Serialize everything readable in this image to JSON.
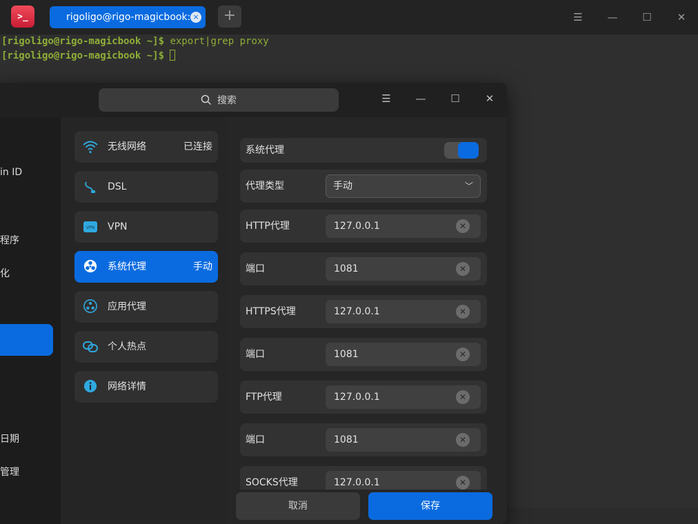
{
  "terminal": {
    "tab_title": "rigoligo@rigo-magicbook:~",
    "tab_close": "×",
    "new_tab": "+",
    "app_icon_glyph": ">_",
    "lines": [
      {
        "user": "[rigoligo@rigo-magicbook ~]$",
        "cmd": " export|grep proxy"
      },
      {
        "user": "[rigoligo@rigo-magicbook ~]$",
        "cmd": " "
      }
    ]
  },
  "window_controls": {
    "menu": "☰",
    "minimize": "—",
    "maximize": "☐",
    "close": "✕"
  },
  "settings": {
    "search_placeholder": "搜索",
    "left_items": [
      {
        "label": "in ID"
      },
      {
        "label": "程序"
      },
      {
        "label": "化"
      },
      {
        "label": "日期"
      },
      {
        "label": "管理"
      }
    ],
    "network_items": [
      {
        "label": "无线网络",
        "status": "已连接",
        "icon": "wifi-icon"
      },
      {
        "label": "DSL",
        "status": "",
        "icon": "dsl-icon"
      },
      {
        "label": "VPN",
        "status": "",
        "icon": "vpn-icon"
      },
      {
        "label": "系统代理",
        "status": "手动",
        "icon": "system-proxy-icon"
      },
      {
        "label": "应用代理",
        "status": "",
        "icon": "app-proxy-icon"
      },
      {
        "label": "个人热点",
        "status": "",
        "icon": "hotspot-icon"
      },
      {
        "label": "网络详情",
        "status": "",
        "icon": "info-icon"
      }
    ],
    "form": {
      "system_proxy_label": "系统代理",
      "system_proxy_enabled": true,
      "proxy_type_label": "代理类型",
      "proxy_type_value": "手动",
      "http_label": "HTTP代理",
      "http_value": "127.0.0.1",
      "http_port_label": "端口",
      "http_port_value": "1081",
      "https_label": "HTTPS代理",
      "https_value": "127.0.0.1",
      "https_port_label": "端口",
      "https_port_value": "1081",
      "ftp_label": "FTP代理",
      "ftp_value": "127.0.0.1",
      "ftp_port_label": "端口",
      "ftp_port_value": "1081",
      "socks_label": "SOCKS代理",
      "socks_value": "127.0.0.1"
    },
    "buttons": {
      "cancel": "取消",
      "save": "保存"
    }
  },
  "colors": {
    "accent": "#0a6be0",
    "prompt_green": "#8fae37"
  }
}
